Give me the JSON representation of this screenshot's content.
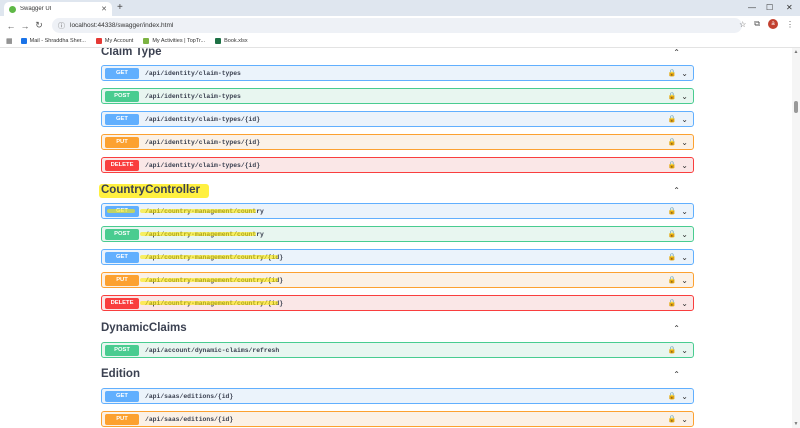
{
  "browser": {
    "tab_title": "Swagger UI",
    "new_tab": "+",
    "address": "localhost:44338/swagger/index.html",
    "profile_initial": "a",
    "bookmarks": [
      {
        "label": "Mail - Shraddha Sher...",
        "color": "#1a73e8"
      },
      {
        "label": "My Account",
        "color": "#e53935"
      },
      {
        "label": "My Activities | TopTr...",
        "color": "#7cb342"
      },
      {
        "label": "Book.xlsx",
        "color": "#1e7145"
      }
    ]
  },
  "groups": [
    {
      "title": "Claim Type",
      "operations": [
        {
          "method": "GET",
          "path": "/api/identity/claim-types"
        },
        {
          "method": "POST",
          "path": "/api/identity/claim-types"
        },
        {
          "method": "GET",
          "path": "/api/identity/claim-types/{id}"
        },
        {
          "method": "PUT",
          "path": "/api/identity/claim-types/{id}"
        },
        {
          "method": "DELETE",
          "path": "/api/identity/claim-types/{id}"
        }
      ]
    },
    {
      "title": "CountryController",
      "operations": [
        {
          "method": "GET",
          "path": "/api/country-management/country"
        },
        {
          "method": "POST",
          "path": "/api/country-management/country"
        },
        {
          "method": "GET",
          "path": "/api/country-management/country/{id}"
        },
        {
          "method": "PUT",
          "path": "/api/country-management/country/{id}"
        },
        {
          "method": "DELETE",
          "path": "/api/country-management/country/{id}"
        }
      ]
    },
    {
      "title": "DynamicClaims",
      "operations": [
        {
          "method": "POST",
          "path": "/api/account/dynamic-claims/refresh"
        }
      ]
    },
    {
      "title": "Edition",
      "operations": [
        {
          "method": "GET",
          "path": "/api/saas/editions/{id}"
        },
        {
          "method": "PUT",
          "path": "/api/saas/editions/{id}"
        }
      ]
    }
  ],
  "colors": {
    "get": "#61affe",
    "post": "#49cc90",
    "put": "#fca130",
    "delete": "#f93e3e",
    "highlight": "#ffeb00"
  },
  "icons": {
    "lock": "lock-icon",
    "chevron": "chevron-down-icon",
    "group_chevron": "chevron-up-icon"
  }
}
